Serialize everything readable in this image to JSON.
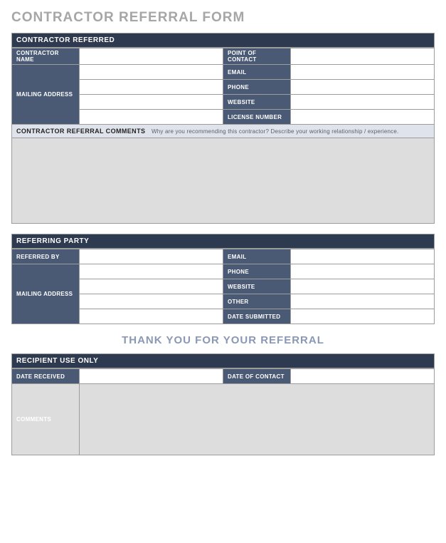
{
  "form_title": "CONTRACTOR REFERRAL FORM",
  "section1": {
    "header": "CONTRACTOR REFERRED",
    "labels": {
      "contractor_name": "CONTRACTOR NAME",
      "mailing_address": "MAILING ADDRESS",
      "point_of_contact": "POINT OF CONTACT",
      "email": "EMAIL",
      "phone": "PHONE",
      "website": "WEBSITE",
      "license_number": "LICENSE NUMBER"
    },
    "comments_label": "CONTRACTOR REFERRAL COMMENTS",
    "comments_help": "Why are you recommending this contractor? Describe your working relationship / experience."
  },
  "section2": {
    "header": "REFERRING PARTY",
    "labels": {
      "referred_by": "REFERRED BY",
      "mailing_address": "MAILING ADDRESS",
      "email": "EMAIL",
      "phone": "PHONE",
      "website": "WEBSITE",
      "other": "OTHER",
      "date_submitted": "DATE SUBMITTED"
    }
  },
  "thank_you": "THANK YOU FOR YOUR REFERRAL",
  "section3": {
    "header": "RECIPIENT USE ONLY",
    "labels": {
      "date_received": "DATE RECEIVED",
      "date_of_contact": "DATE OF CONTACT",
      "comments": "COMMENTS"
    }
  }
}
